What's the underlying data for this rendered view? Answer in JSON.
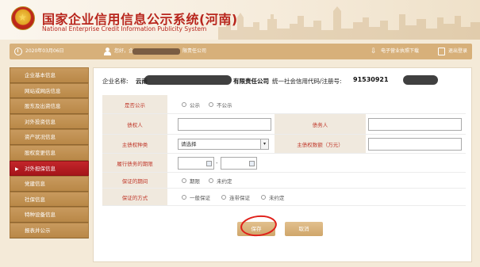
{
  "header": {
    "title": "国家企业信用信息公示系统(河南)",
    "subtitle": "National Enterprise Credit Information Publicity System"
  },
  "topbar": {
    "date": "2020年03月06日",
    "user_prefix": "您好，企",
    "user_suffix": "限责任公司",
    "download_label": "电子营业执照下载",
    "logout_label": "退出登录"
  },
  "sidebar": {
    "items": [
      {
        "label": "企业基本信息",
        "active": false
      },
      {
        "label": "网站或网店信息",
        "active": false
      },
      {
        "label": "股东及出资信息",
        "active": false
      },
      {
        "label": "对外投资信息",
        "active": false
      },
      {
        "label": "资产状况信息",
        "active": false
      },
      {
        "label": "股权变更信息",
        "active": false
      },
      {
        "label": "对外担保信息",
        "active": true
      },
      {
        "label": "党建信息",
        "active": false
      },
      {
        "label": "社保信息",
        "active": false
      },
      {
        "label": "特种设备信息",
        "active": false
      },
      {
        "label": "报表并公示",
        "active": false
      }
    ]
  },
  "company": {
    "name_label": "企业名称:",
    "name_value": "云南",
    "name_value_suffix": "有限责任公司",
    "credit_label": "统一社会信用代码/注册号:",
    "credit_value": "91530921"
  },
  "form": {
    "publicity_label": "是否公示",
    "publicity_options": [
      "公示",
      "不公示"
    ],
    "creditor_label": "债权人",
    "debtor_label": "债务人",
    "claim_type_label": "主债权种类",
    "claim_type_value": "请选择",
    "claim_amount_label": "主债权数额（万元）",
    "term_label": "履行债务的期限",
    "date_separator": "-",
    "guarantee_period_label": "保证的期间",
    "guarantee_period_options": [
      "期限",
      "未约定"
    ],
    "guarantee_method_label": "保证的方式",
    "guarantee_method_options": [
      "一般保证",
      "连带保证",
      "未约定"
    ]
  },
  "buttons": {
    "save_label": "保存",
    "cancel_label": "取消"
  }
}
